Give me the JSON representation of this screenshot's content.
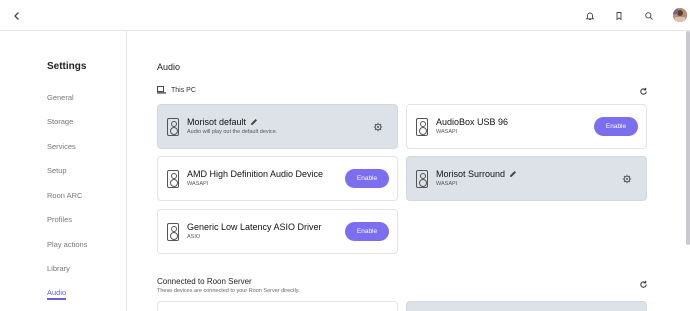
{
  "sidebar": {
    "title": "Settings",
    "items": [
      "General",
      "Storage",
      "Services",
      "Setup",
      "Roon ARC",
      "Profiles",
      "Play actions",
      "Library",
      "Audio"
    ],
    "active": "Audio"
  },
  "main": {
    "section_title": "Audio",
    "this_pc_label": "This PC",
    "devices": [
      {
        "name": "Morisot default",
        "subtitle": "Audio will play out the default device.",
        "state": "selected"
      },
      {
        "name": "AudioBox USB 96",
        "subtitle": "WASAPI",
        "state": "enable"
      },
      {
        "name": "AMD High Definition Audio Device",
        "subtitle": "WASAPI",
        "state": "enable"
      },
      {
        "name": "Morisot Surround",
        "subtitle": "WASAPI",
        "state": "selected"
      },
      {
        "name": "Generic Low Latency ASIO Driver",
        "subtitle": "ASIO",
        "state": "enable"
      }
    ],
    "enable_label": "Enable",
    "server_section_title": "Connected to Roon Server",
    "server_section_subtitle": "These devices are connected to your Roon Server directly."
  },
  "colors": {
    "accent": "#7b6ff0",
    "active_nav": "#6a5fd8",
    "selected_card": "#dde1e8"
  },
  "icons": [
    "chevron-left-icon",
    "bell-icon",
    "bookmark-icon",
    "search-icon",
    "avatar",
    "pc-icon",
    "refresh-icon",
    "speaker-icon",
    "pencil-icon",
    "gear-icon"
  ]
}
